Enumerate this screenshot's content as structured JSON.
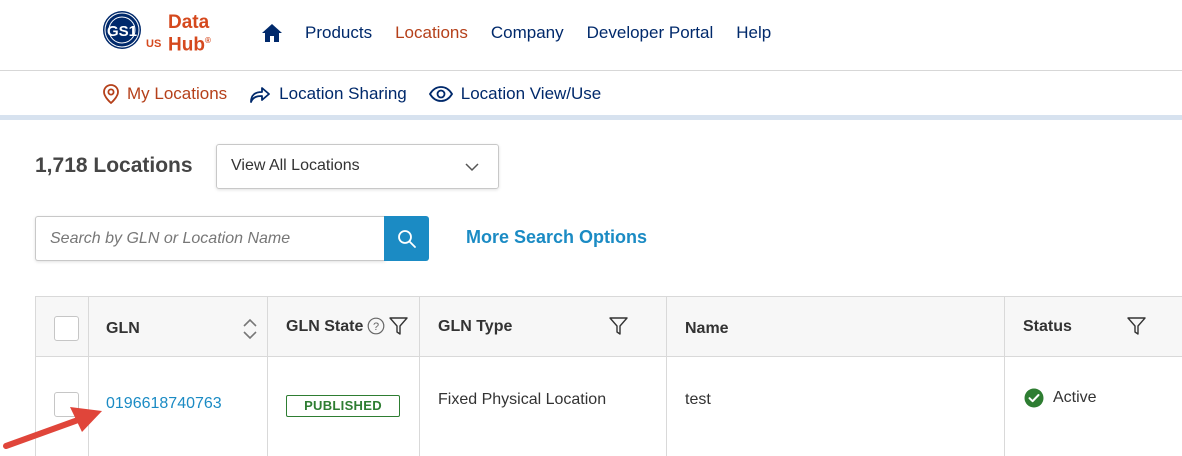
{
  "brand": {
    "gs1": "GS1",
    "us": "US",
    "line1": "Data",
    "line2": "Hub",
    "reg": "®",
    "gs1_color": "#00296b",
    "accent_color": "#d5491e"
  },
  "nav": {
    "home_icon": "home-icon",
    "items": [
      {
        "label": "Products"
      },
      {
        "label": "Locations",
        "active": true
      },
      {
        "label": "Company"
      },
      {
        "label": "Developer Portal"
      },
      {
        "label": "Help"
      }
    ]
  },
  "subnav": {
    "items": [
      {
        "label": "My Locations",
        "icon": "map-pin-icon",
        "active": true
      },
      {
        "label": "Location Sharing",
        "icon": "share-arrow-icon"
      },
      {
        "label": "Location View/Use",
        "icon": "eye-icon"
      }
    ]
  },
  "summary": {
    "count_label": "1,718 Locations"
  },
  "view_select": {
    "selected": "View All Locations"
  },
  "search": {
    "placeholder": "Search by GLN or Location Name",
    "value": "",
    "more_options": "More Search Options"
  },
  "table": {
    "headers": {
      "gln": "GLN",
      "gln_state": "GLN State",
      "gln_type": "GLN Type",
      "name": "Name",
      "status": "Status"
    },
    "rows": [
      {
        "gln": "0196618740763",
        "gln_state": "PUBLISHED",
        "gln_type": "Fixed Physical Location",
        "name": "test",
        "status": "Active"
      }
    ]
  },
  "colors": {
    "link": "#1b8bc4",
    "nav_text": "#00296b",
    "active_nav": "#b5401a",
    "published_green": "#2e7d32",
    "annotation_arrow": "#e0453a"
  }
}
